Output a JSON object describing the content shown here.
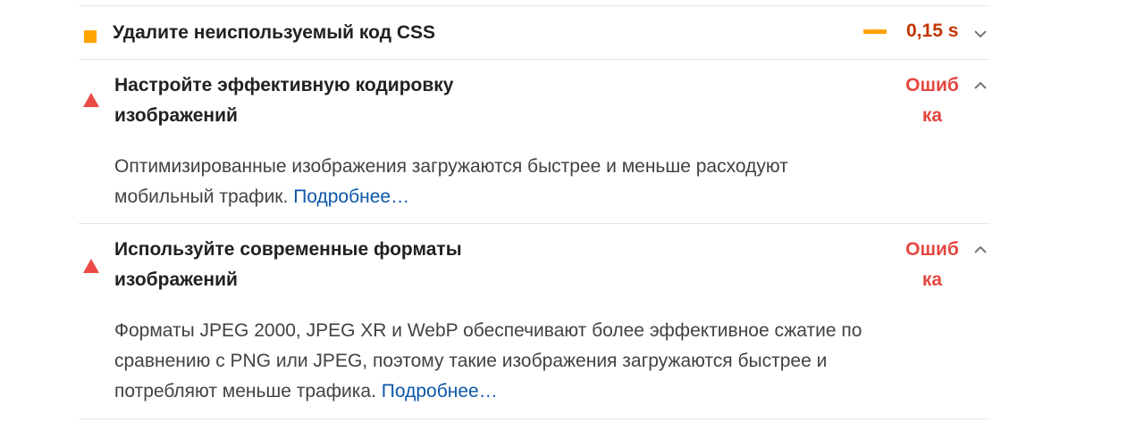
{
  "audits": [
    {
      "title": "Удалите неиспользуемый код CSS",
      "status": "0,15 s",
      "status_color": "#c33300",
      "icon": "warning-square-icon",
      "icon_color": "#ffa400",
      "chevron": "chevron-down-icon"
    },
    {
      "title_line1": "Настройте эффективную кодировку",
      "title_line2": "изображений",
      "status_line1": "Ошиб",
      "status_line2": "ка",
      "status_color": "#e5473f",
      "icon": "error-triangle-icon",
      "chevron": "chevron-up-icon",
      "description_line1": "Оптимизированные изображения загружаются быстрее и меньше расходуют",
      "description_line2": "мобильный трафик.",
      "link_text": "Подробнее…"
    },
    {
      "title_line1": "Используйте современные форматы",
      "title_line2": "изображений",
      "status_line1": "Ошиб",
      "status_line2": "ка",
      "status_color": "#e5473f",
      "icon": "error-triangle-icon",
      "chevron": "chevron-up-icon",
      "description_line1": "Форматы JPEG 2000, JPEG XR и WebP обеспечивают более эффективное сжатие по",
      "description_line2": "сравнению с PNG или JPEG, поэтому такие изображения загружаются быстрее и",
      "description_line3": "потребляют меньше трафика.",
      "link_text": "Подробнее…"
    }
  ]
}
